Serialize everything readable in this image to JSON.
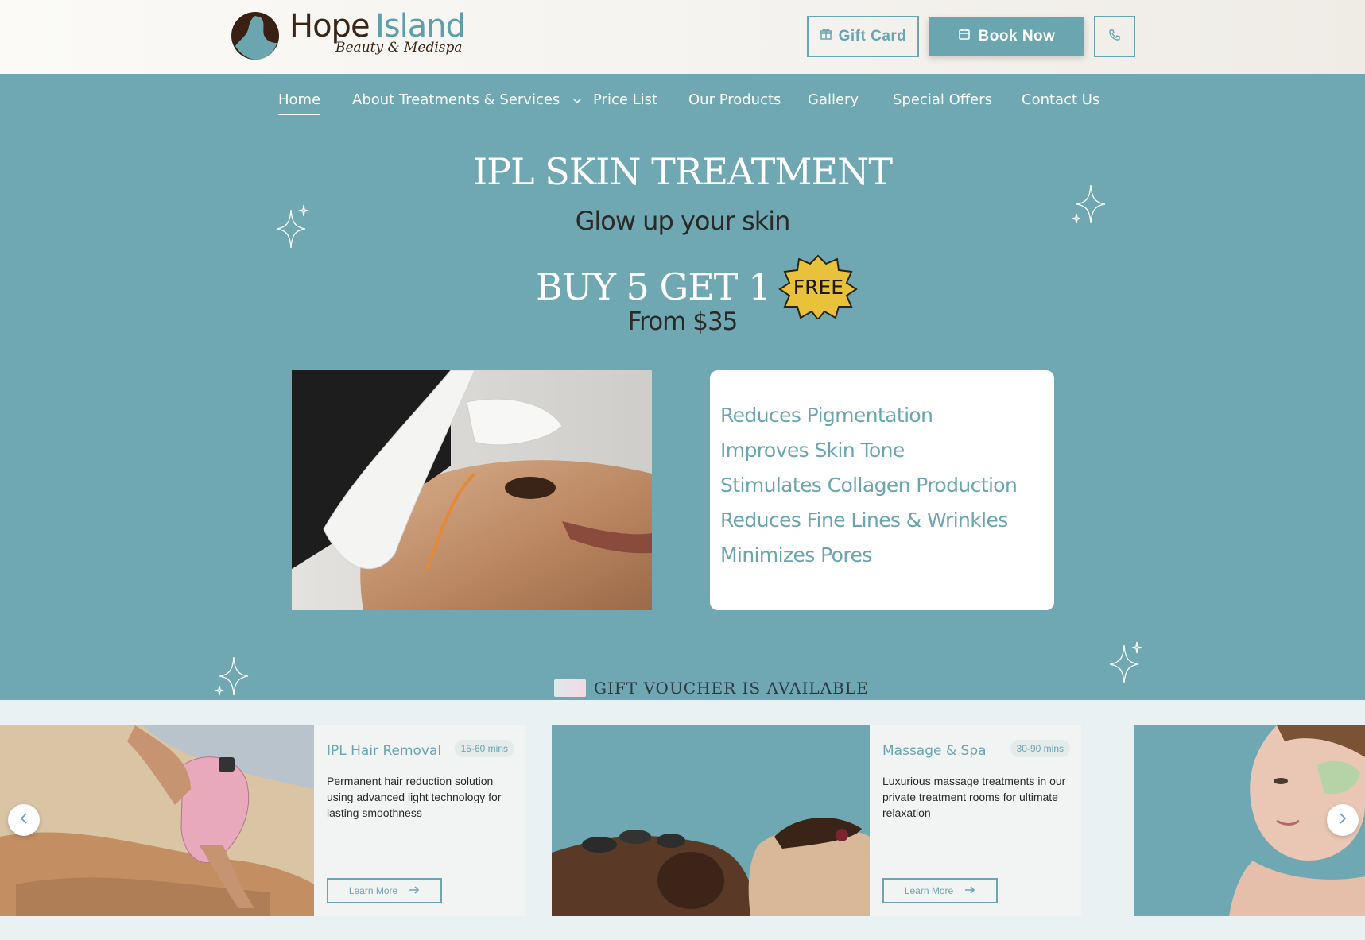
{
  "header": {
    "brand_primary": "Hope",
    "brand_secondary": "Island",
    "brand_tagline": "Beauty & Medispa",
    "gift_label": "Gift Card",
    "book_label": "Book Now"
  },
  "nav": {
    "items": [
      {
        "label": "Home",
        "active": true
      },
      {
        "label": "About Treatments & Services"
      },
      {
        "label": "Price List"
      },
      {
        "label": "Our Products"
      },
      {
        "label": "Gallery"
      },
      {
        "label": "Special Offers"
      },
      {
        "label": "Contact Us"
      }
    ]
  },
  "hero": {
    "title": "IPL SKIN TREATMENT",
    "subtitle": "Glow up your skin",
    "offer": "BUY 5 GET 1",
    "badge": "FREE",
    "price": "From $35",
    "benefits": [
      "Reduces Pigmentation",
      "Improves Skin Tone",
      "Stimulates Collagen Production",
      "Reduces Fine Lines & Wrinkles",
      "Minimizes Pores"
    ],
    "voucher_text": "GIFT VOUCHER IS AVAILABLE"
  },
  "services": {
    "cards": [
      {
        "title": "IPL Hair Removal",
        "duration": "15-60 mins",
        "description": "Permanent hair reduction solution using advanced light technology for lasting smoothness",
        "button": "Learn More"
      },
      {
        "title": "Massage & Spa",
        "duration": "30-90 mins",
        "description": "Luxurious massage treatments in our private treatment rooms for ultimate relaxation",
        "button": "Learn More"
      }
    ]
  },
  "colors": {
    "accent": "#6fa8b2",
    "brand_brown": "#3a2617",
    "badge_yellow": "#e8c23a",
    "card_bg": "#f1f4f3"
  },
  "icons": {
    "gift": "gift-icon",
    "calendar": "calendar-icon",
    "phone": "phone-icon",
    "chevron": "chevron-down-icon",
    "arrow_right": "arrow-right-icon",
    "prev": "chevron-left-icon",
    "next": "chevron-right-icon",
    "sparkle": "sparkle-icon"
  }
}
